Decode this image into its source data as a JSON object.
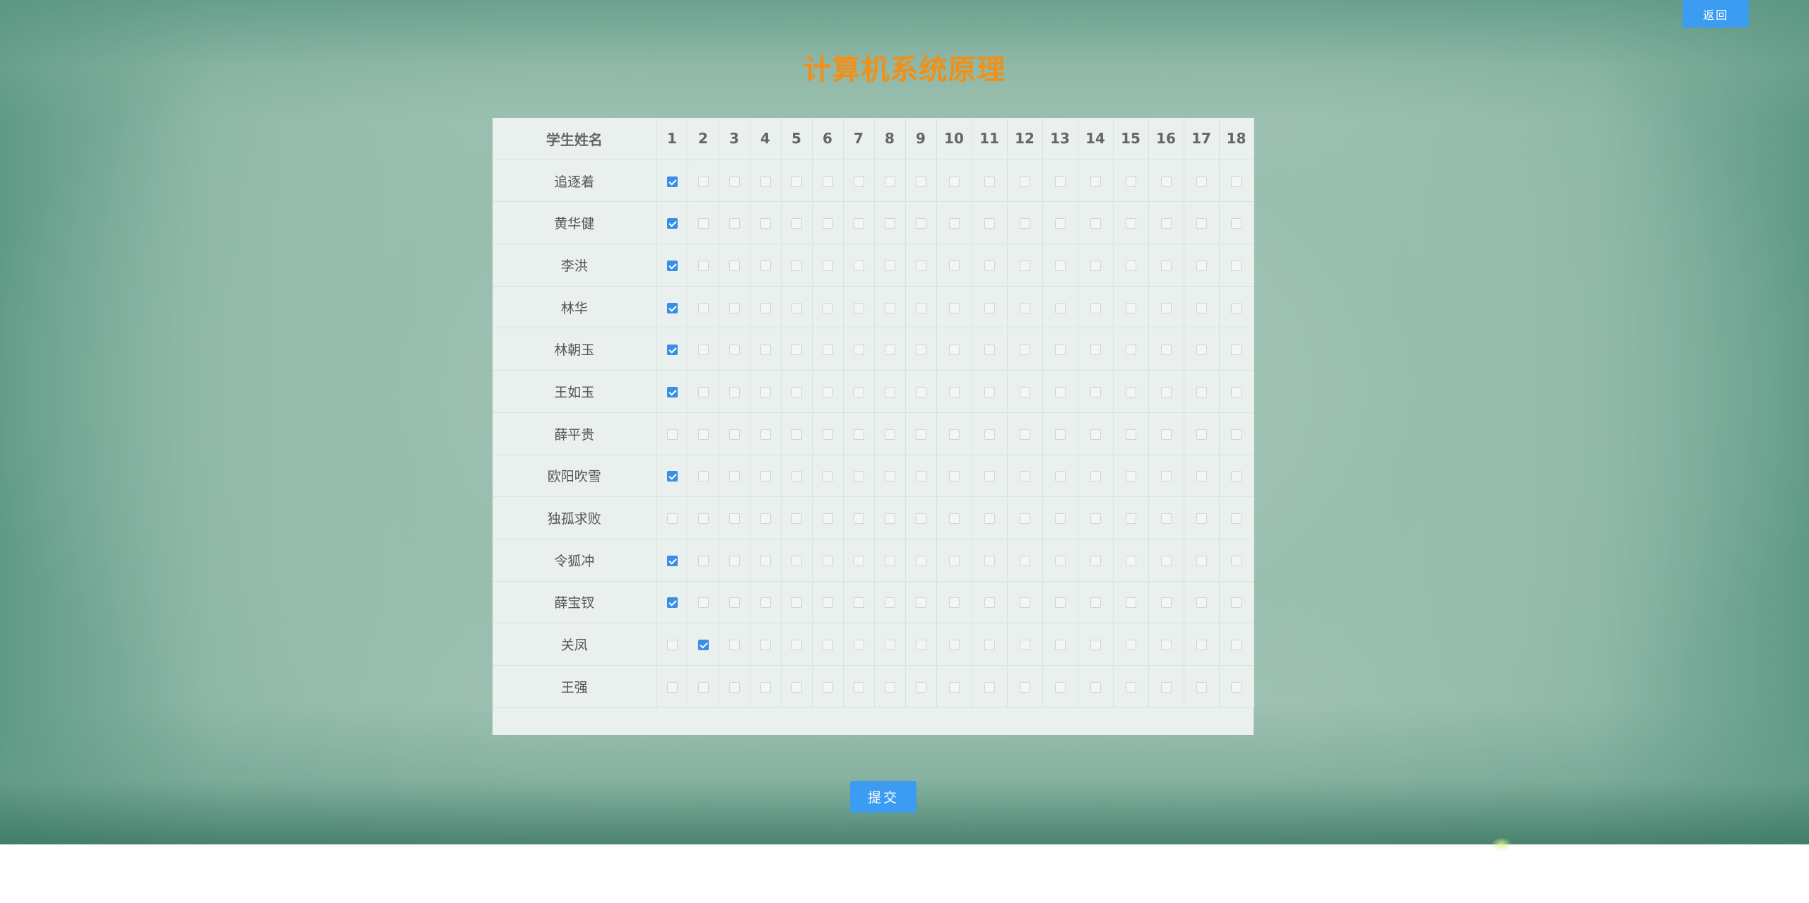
{
  "header": {
    "back_label": "返回",
    "title": "计算机系统原理"
  },
  "table": {
    "name_header": "学生姓名",
    "sessions": [
      "1",
      "2",
      "3",
      "4",
      "5",
      "6",
      "7",
      "8",
      "9",
      "10",
      "11",
      "12",
      "13",
      "14",
      "15",
      "16",
      "17",
      "18"
    ],
    "students": [
      {
        "name": "追逐着",
        "checked": [
          1
        ]
      },
      {
        "name": "黄华健",
        "checked": [
          1
        ]
      },
      {
        "name": "李洪",
        "checked": [
          1
        ]
      },
      {
        "name": "林华",
        "checked": [
          1
        ]
      },
      {
        "name": "林朝玉",
        "checked": [
          1
        ]
      },
      {
        "name": "王如玉",
        "checked": [
          1
        ]
      },
      {
        "name": "薛平贵",
        "checked": []
      },
      {
        "name": "欧阳吹雪",
        "checked": [
          1
        ]
      },
      {
        "name": "独孤求败",
        "checked": []
      },
      {
        "name": "令狐冲",
        "checked": [
          1
        ]
      },
      {
        "name": "薛宝钗",
        "checked": [
          1
        ]
      },
      {
        "name": "关凤",
        "checked": [
          2
        ]
      },
      {
        "name": "王强",
        "checked": []
      }
    ]
  },
  "footer": {
    "submit_label": "提交"
  },
  "colors": {
    "accent": "#3b9cf2",
    "title": "#f09019",
    "checkbox_checked": "#3a8ee6"
  }
}
